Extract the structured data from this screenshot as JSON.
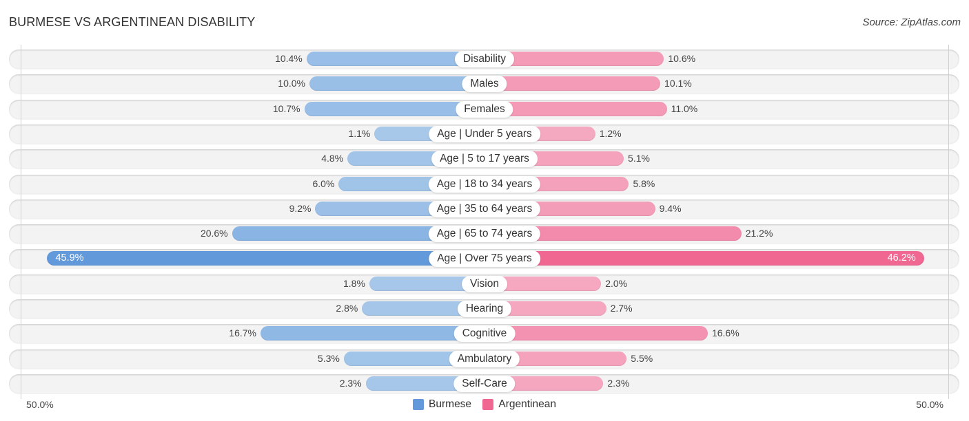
{
  "header": {
    "title": "BURMESE VS ARGENTINEAN DISABILITY",
    "source": "Source: ZipAtlas.com"
  },
  "colors": {
    "burmese_strong": "#6199db",
    "burmese_light": "#a8c8ea",
    "argentinean_strong": "#f06792",
    "argentinean_light": "#f5a9c1"
  },
  "chart_data": {
    "type": "bar",
    "orientation": "horizontal-diverging",
    "title": "BURMESE VS ARGENTINEAN DISABILITY",
    "xlabel": "",
    "ylabel": "",
    "xlim": [
      0,
      50.0
    ],
    "axis_labels": {
      "left": "50.0%",
      "right": "50.0%"
    },
    "legend": {
      "position": "bottom-center",
      "entries": [
        "Burmese",
        "Argentinean"
      ]
    },
    "categories": [
      "Disability",
      "Males",
      "Females",
      "Age | Under 5 years",
      "Age | 5 to 17 years",
      "Age | 18 to 34 years",
      "Age | 35 to 64 years",
      "Age | 65 to 74 years",
      "Age | Over 75 years",
      "Vision",
      "Hearing",
      "Cognitive",
      "Ambulatory",
      "Self-Care"
    ],
    "series": [
      {
        "name": "Burmese",
        "side": "left",
        "values": [
          10.4,
          10.0,
          10.7,
          1.1,
          4.8,
          6.0,
          9.2,
          20.6,
          45.9,
          1.8,
          2.8,
          16.7,
          5.3,
          2.3
        ],
        "labels": [
          "10.4%",
          "10.0%",
          "10.7%",
          "1.1%",
          "4.8%",
          "6.0%",
          "9.2%",
          "20.6%",
          "45.9%",
          "1.8%",
          "2.8%",
          "16.7%",
          "5.3%",
          "2.3%"
        ]
      },
      {
        "name": "Argentinean",
        "side": "right",
        "values": [
          10.6,
          10.1,
          11.0,
          1.2,
          5.1,
          5.8,
          9.4,
          21.2,
          46.2,
          2.0,
          2.7,
          16.6,
          5.5,
          2.3
        ],
        "labels": [
          "10.6%",
          "10.1%",
          "11.0%",
          "1.2%",
          "5.1%",
          "5.8%",
          "9.4%",
          "21.2%",
          "46.2%",
          "2.0%",
          "2.7%",
          "16.6%",
          "5.5%",
          "2.3%"
        ]
      }
    ]
  }
}
